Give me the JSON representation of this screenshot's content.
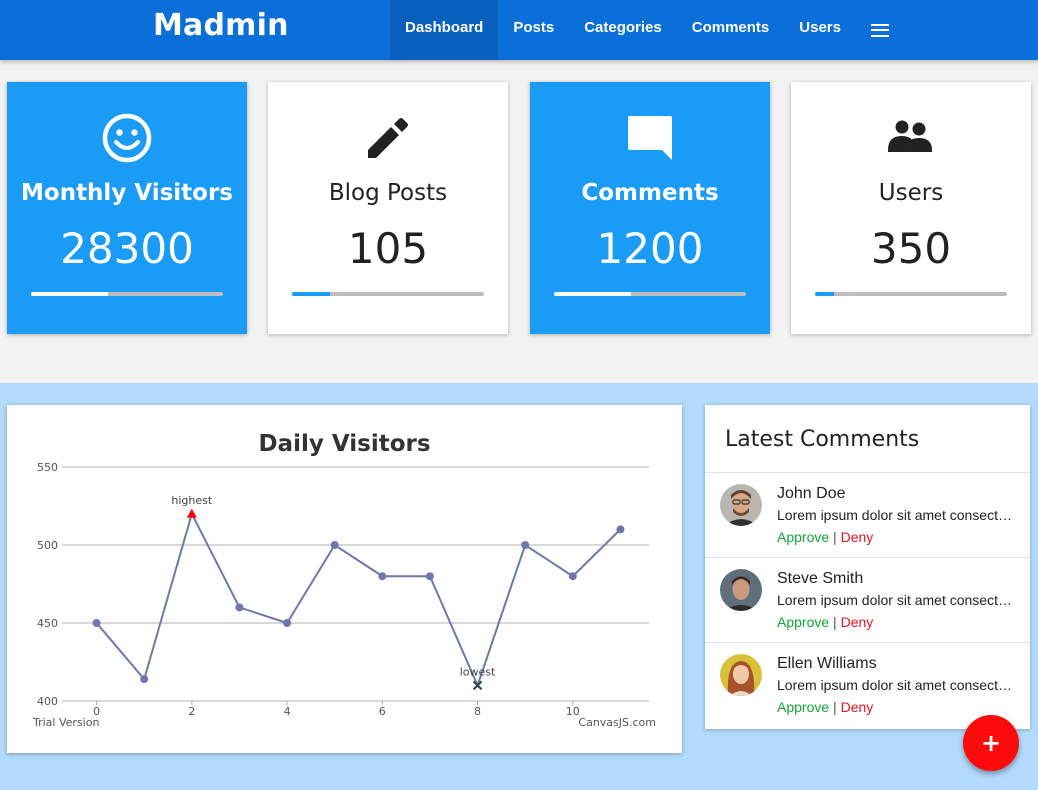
{
  "app": {
    "brand": "Madmin"
  },
  "nav": {
    "items": [
      "Dashboard",
      "Posts",
      "Categories",
      "Comments",
      "Users"
    ],
    "active": "Dashboard",
    "menu_icon": "hamburger-icon"
  },
  "stats": [
    {
      "title": "Monthly Visitors",
      "value": "28300",
      "icon": "smiley-icon",
      "progress": 0.4,
      "style": "blue"
    },
    {
      "title": "Blog Posts",
      "value": "105",
      "icon": "pencil-icon",
      "progress": 0.2,
      "style": "white"
    },
    {
      "title": "Comments",
      "value": "1200",
      "icon": "comment-icon",
      "progress": 0.4,
      "style": "blue"
    },
    {
      "title": "Users",
      "value": "350",
      "icon": "users-icon",
      "progress": 0.1,
      "style": "white"
    }
  ],
  "colors": {
    "topbar": "#0a6fd8",
    "card_blue": "#1a9cf6",
    "lower_bg": "#b3dafc",
    "line": "#6d78ad",
    "approve": "#13a538",
    "deny": "#e3151b",
    "fab": "#fb0b0b"
  },
  "chart_data": {
    "type": "line",
    "title": "Daily Visitors",
    "x": [
      0,
      1,
      2,
      3,
      4,
      5,
      6,
      7,
      8,
      9,
      10,
      11
    ],
    "y": [
      450,
      414,
      520,
      460,
      450,
      500,
      480,
      480,
      410,
      500,
      480,
      510
    ],
    "xlim": [
      -0.6,
      11.6
    ],
    "ylim": [
      400,
      550
    ],
    "xticks": [
      0,
      2,
      4,
      6,
      8,
      10
    ],
    "yticks": [
      400,
      450,
      500,
      550
    ],
    "annotations": [
      {
        "x": 2,
        "y": 520,
        "label": "highest",
        "marker": "triangle",
        "color": "#ff0000"
      },
      {
        "x": 8,
        "y": 410,
        "label": "lowest",
        "marker": "cross",
        "color": "#2a4d4d"
      }
    ],
    "grid": true,
    "watermark_left": "Trial Version",
    "watermark_right": "CanvasJS.com"
  },
  "comments": {
    "title": "Latest Comments",
    "items": [
      {
        "name": "John Doe",
        "text": "Lorem ipsum dolor sit amet consectetur adipisicing elit.",
        "approve": "Approve",
        "deny": "Deny",
        "sep": "|"
      },
      {
        "name": "Steve Smith",
        "text": "Lorem ipsum dolor sit amet consectetur adipisicing elit.",
        "approve": "Approve",
        "deny": "Deny",
        "sep": "|"
      },
      {
        "name": "Ellen Williams",
        "text": "Lorem ipsum dolor sit amet consectetur adipisicing elit.",
        "approve": "Approve",
        "deny": "Deny",
        "sep": "|"
      }
    ]
  },
  "fab": {
    "label": "+"
  }
}
